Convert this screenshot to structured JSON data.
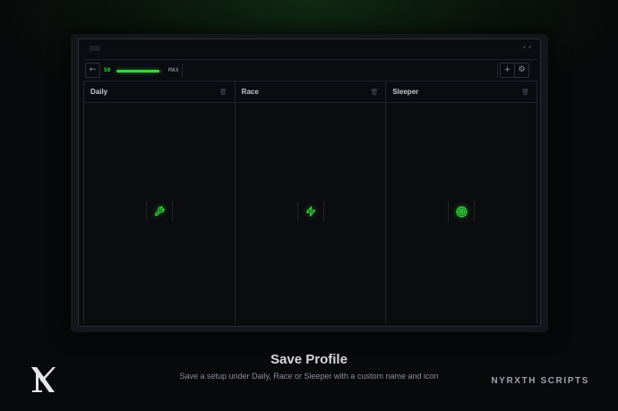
{
  "toolbar": {
    "back_icon": "arrow-left-icon",
    "value": "50",
    "slider_fraction": 0.95,
    "max_label": "MAX",
    "add_icon": "plus-icon",
    "settings_icon": "gear-icon"
  },
  "profiles": [
    {
      "name": "Daily",
      "icon": "wrench-icon"
    },
    {
      "name": "Race",
      "icon": "lightning-bolt-icon"
    },
    {
      "name": "Sleeper",
      "icon": "target-icon"
    }
  ],
  "caption": {
    "title": "Save Profile",
    "subtitle": "Save a setup under Daily, Race or Sleeper with a custom name and icon"
  },
  "brand": "NYRXTH SCRIPTS",
  "colors": {
    "accent": "#33d93a",
    "background": "#08090a",
    "panel": "#0b0c10"
  }
}
